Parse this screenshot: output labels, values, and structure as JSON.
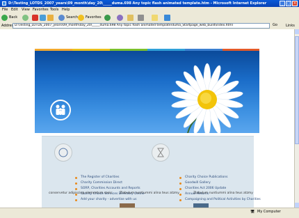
{
  "window": {
    "title": "D:\\Testing_LOTDS_2007_years\\09_month\\day_20\\_____duma.698 Any topic flash animated template.htm - Microsoft Internet Explorer"
  },
  "menu": [
    "File",
    "Edit",
    "View",
    "Favorites",
    "Tools",
    "Help"
  ],
  "toolbar": {
    "back": "Back",
    "search": "Search",
    "favorites": "Favorites"
  },
  "address": {
    "label": "Address",
    "value": "D:\\Testing_LOTDS_2007_years\\09_month\\day_20\\_____duma.698 Any topic flash animated template\\duma_Startpage_web_build\\index.html",
    "go": "Go",
    "links": "Links"
  },
  "status": {
    "zone": "My Computer"
  },
  "page": {
    "quicklinks_left": [
      "The Register of Charities",
      "Charity Commission Direct",
      "SORP, Charities Accounts and Reports",
      "Charity Choice Services Directory Online",
      "Add your charity - advertise with us"
    ],
    "quicklinks_right": [
      "Charity Choice Publications",
      "Goodwill Gallery",
      "Charities Act 2006 Update",
      "Annual Returns",
      "Campaigning and Political Activities by Charities"
    ],
    "section_titles": [
      "conservetur adipiscing elementum sesis",
      "Zlabulum nuntiummi alina teus atzmy",
      "Zlabulum nuntiummi alina teus atzmy"
    ]
  },
  "colors": {
    "strip": [
      "#f0a830",
      "#e8c020",
      "#7bbf2e",
      "#2fa0d8",
      "#3a7fd0",
      "#e25a2a"
    ]
  }
}
